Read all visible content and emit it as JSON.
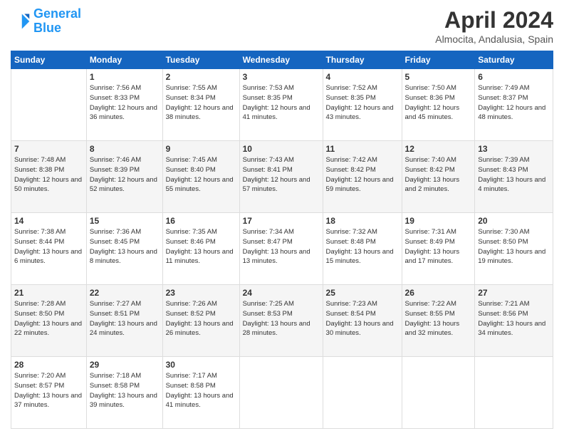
{
  "logo": {
    "line1": "General",
    "line2": "Blue"
  },
  "title": "April 2024",
  "subtitle": "Almocita, Andalusia, Spain",
  "headers": [
    "Sunday",
    "Monday",
    "Tuesday",
    "Wednesday",
    "Thursday",
    "Friday",
    "Saturday"
  ],
  "weeks": [
    [
      {
        "day": "",
        "sunrise": "",
        "sunset": "",
        "daylight": ""
      },
      {
        "day": "1",
        "sunrise": "Sunrise: 7:56 AM",
        "sunset": "Sunset: 8:33 PM",
        "daylight": "Daylight: 12 hours and 36 minutes."
      },
      {
        "day": "2",
        "sunrise": "Sunrise: 7:55 AM",
        "sunset": "Sunset: 8:34 PM",
        "daylight": "Daylight: 12 hours and 38 minutes."
      },
      {
        "day": "3",
        "sunrise": "Sunrise: 7:53 AM",
        "sunset": "Sunset: 8:35 PM",
        "daylight": "Daylight: 12 hours and 41 minutes."
      },
      {
        "day": "4",
        "sunrise": "Sunrise: 7:52 AM",
        "sunset": "Sunset: 8:35 PM",
        "daylight": "Daylight: 12 hours and 43 minutes."
      },
      {
        "day": "5",
        "sunrise": "Sunrise: 7:50 AM",
        "sunset": "Sunset: 8:36 PM",
        "daylight": "Daylight: 12 hours and 45 minutes."
      },
      {
        "day": "6",
        "sunrise": "Sunrise: 7:49 AM",
        "sunset": "Sunset: 8:37 PM",
        "daylight": "Daylight: 12 hours and 48 minutes."
      }
    ],
    [
      {
        "day": "7",
        "sunrise": "Sunrise: 7:48 AM",
        "sunset": "Sunset: 8:38 PM",
        "daylight": "Daylight: 12 hours and 50 minutes."
      },
      {
        "day": "8",
        "sunrise": "Sunrise: 7:46 AM",
        "sunset": "Sunset: 8:39 PM",
        "daylight": "Daylight: 12 hours and 52 minutes."
      },
      {
        "day": "9",
        "sunrise": "Sunrise: 7:45 AM",
        "sunset": "Sunset: 8:40 PM",
        "daylight": "Daylight: 12 hours and 55 minutes."
      },
      {
        "day": "10",
        "sunrise": "Sunrise: 7:43 AM",
        "sunset": "Sunset: 8:41 PM",
        "daylight": "Daylight: 12 hours and 57 minutes."
      },
      {
        "day": "11",
        "sunrise": "Sunrise: 7:42 AM",
        "sunset": "Sunset: 8:42 PM",
        "daylight": "Daylight: 12 hours and 59 minutes."
      },
      {
        "day": "12",
        "sunrise": "Sunrise: 7:40 AM",
        "sunset": "Sunset: 8:42 PM",
        "daylight": "Daylight: 13 hours and 2 minutes."
      },
      {
        "day": "13",
        "sunrise": "Sunrise: 7:39 AM",
        "sunset": "Sunset: 8:43 PM",
        "daylight": "Daylight: 13 hours and 4 minutes."
      }
    ],
    [
      {
        "day": "14",
        "sunrise": "Sunrise: 7:38 AM",
        "sunset": "Sunset: 8:44 PM",
        "daylight": "Daylight: 13 hours and 6 minutes."
      },
      {
        "day": "15",
        "sunrise": "Sunrise: 7:36 AM",
        "sunset": "Sunset: 8:45 PM",
        "daylight": "Daylight: 13 hours and 8 minutes."
      },
      {
        "day": "16",
        "sunrise": "Sunrise: 7:35 AM",
        "sunset": "Sunset: 8:46 PM",
        "daylight": "Daylight: 13 hours and 11 minutes."
      },
      {
        "day": "17",
        "sunrise": "Sunrise: 7:34 AM",
        "sunset": "Sunset: 8:47 PM",
        "daylight": "Daylight: 13 hours and 13 minutes."
      },
      {
        "day": "18",
        "sunrise": "Sunrise: 7:32 AM",
        "sunset": "Sunset: 8:48 PM",
        "daylight": "Daylight: 13 hours and 15 minutes."
      },
      {
        "day": "19",
        "sunrise": "Sunrise: 7:31 AM",
        "sunset": "Sunset: 8:49 PM",
        "daylight": "Daylight: 13 hours and 17 minutes."
      },
      {
        "day": "20",
        "sunrise": "Sunrise: 7:30 AM",
        "sunset": "Sunset: 8:50 PM",
        "daylight": "Daylight: 13 hours and 19 minutes."
      }
    ],
    [
      {
        "day": "21",
        "sunrise": "Sunrise: 7:28 AM",
        "sunset": "Sunset: 8:50 PM",
        "daylight": "Daylight: 13 hours and 22 minutes."
      },
      {
        "day": "22",
        "sunrise": "Sunrise: 7:27 AM",
        "sunset": "Sunset: 8:51 PM",
        "daylight": "Daylight: 13 hours and 24 minutes."
      },
      {
        "day": "23",
        "sunrise": "Sunrise: 7:26 AM",
        "sunset": "Sunset: 8:52 PM",
        "daylight": "Daylight: 13 hours and 26 minutes."
      },
      {
        "day": "24",
        "sunrise": "Sunrise: 7:25 AM",
        "sunset": "Sunset: 8:53 PM",
        "daylight": "Daylight: 13 hours and 28 minutes."
      },
      {
        "day": "25",
        "sunrise": "Sunrise: 7:23 AM",
        "sunset": "Sunset: 8:54 PM",
        "daylight": "Daylight: 13 hours and 30 minutes."
      },
      {
        "day": "26",
        "sunrise": "Sunrise: 7:22 AM",
        "sunset": "Sunset: 8:55 PM",
        "daylight": "Daylight: 13 hours and 32 minutes."
      },
      {
        "day": "27",
        "sunrise": "Sunrise: 7:21 AM",
        "sunset": "Sunset: 8:56 PM",
        "daylight": "Daylight: 13 hours and 34 minutes."
      }
    ],
    [
      {
        "day": "28",
        "sunrise": "Sunrise: 7:20 AM",
        "sunset": "Sunset: 8:57 PM",
        "daylight": "Daylight: 13 hours and 37 minutes."
      },
      {
        "day": "29",
        "sunrise": "Sunrise: 7:18 AM",
        "sunset": "Sunset: 8:58 PM",
        "daylight": "Daylight: 13 hours and 39 minutes."
      },
      {
        "day": "30",
        "sunrise": "Sunrise: 7:17 AM",
        "sunset": "Sunset: 8:58 PM",
        "daylight": "Daylight: 13 hours and 41 minutes."
      },
      {
        "day": "",
        "sunrise": "",
        "sunset": "",
        "daylight": ""
      },
      {
        "day": "",
        "sunrise": "",
        "sunset": "",
        "daylight": ""
      },
      {
        "day": "",
        "sunrise": "",
        "sunset": "",
        "daylight": ""
      },
      {
        "day": "",
        "sunrise": "",
        "sunset": "",
        "daylight": ""
      }
    ]
  ]
}
